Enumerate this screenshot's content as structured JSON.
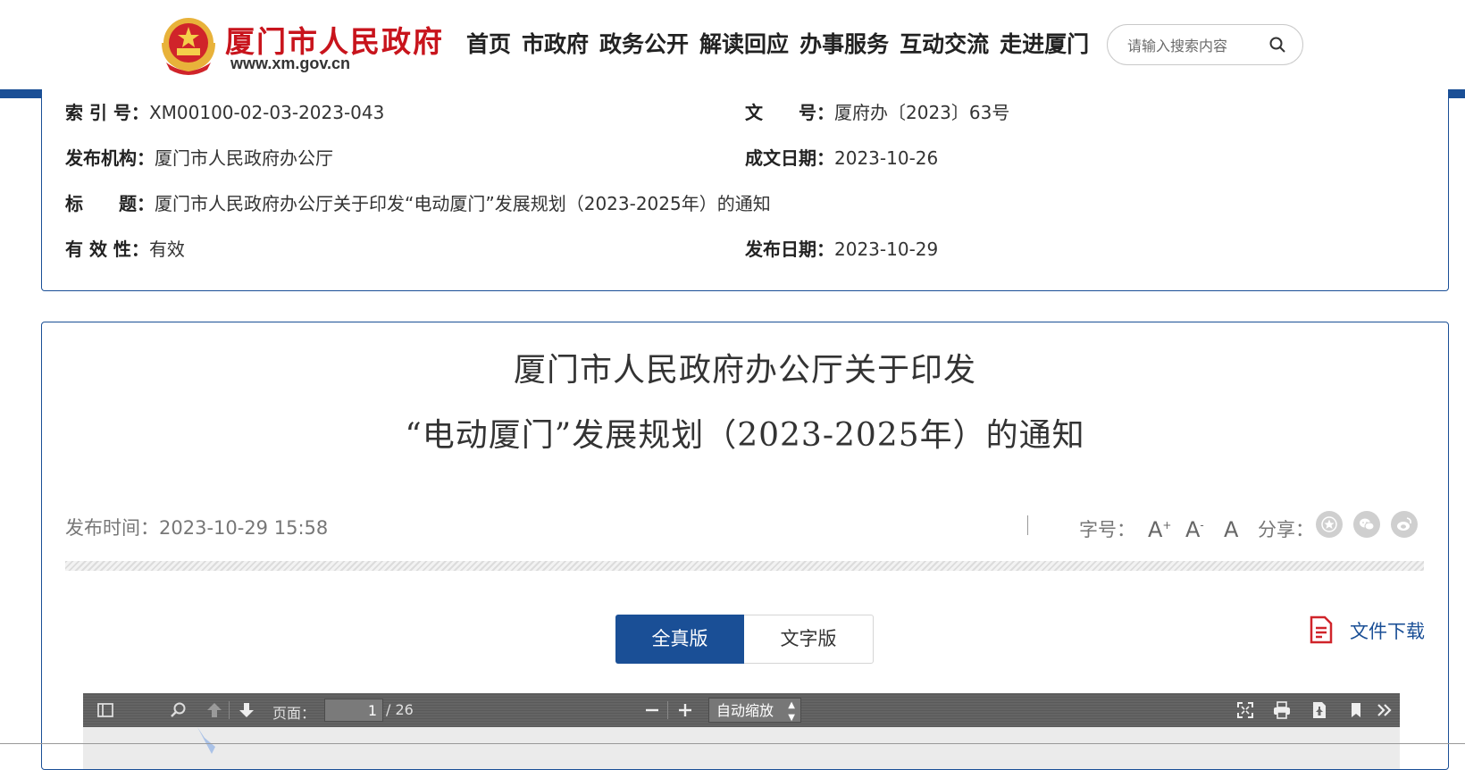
{
  "header": {
    "site_name": "厦门市人民政府",
    "site_url": "www.xm.gov.cn",
    "nav": [
      "首页",
      "市政府",
      "政务公开",
      "解读回应",
      "办事服务",
      "互动交流",
      "走进厦门"
    ],
    "search_placeholder": "请输入搜索内容",
    "brand_color": "#c8141c",
    "accent_color": "#1a4f96"
  },
  "info": {
    "index_label": "索 引 号：",
    "index_value": "XM00100-02-03-2023-043",
    "docno_label": "文　　号：",
    "docno_value": "厦府办〔2023〕63号",
    "org_label": "发布机构：",
    "org_value": "厦门市人民政府办公厅",
    "date_label": "成文日期：",
    "date_value": "2023-10-26",
    "title_label": "标　　题：",
    "title_value": "厦门市人民政府办公厅关于印发“电动厦门”发展规划（2023-2025年）的通知",
    "valid_label": "有 效 性：",
    "valid_value": "有效",
    "pubdate_label": "发布日期：",
    "pubdate_value": "2023-10-29"
  },
  "article": {
    "title_line1": "厦门市人民政府办公厅关于印发",
    "title_line2": "“电动厦门”发展规划（2023-2025年）的通知",
    "pubtime_label": "发布时间：",
    "pubtime_value": "2023-10-29 15:58",
    "fontsize_label": "字号：",
    "font_large": "A",
    "font_small": "A",
    "font_normal": "A",
    "share_label": "分享：",
    "tab_full": "全真版",
    "tab_text": "文字版",
    "download_label": "文件下载"
  },
  "pdf_viewer": {
    "page_label": "页面：",
    "current_page": "1",
    "total_pages": "/ 26",
    "zoom_value": "自动缩放"
  }
}
